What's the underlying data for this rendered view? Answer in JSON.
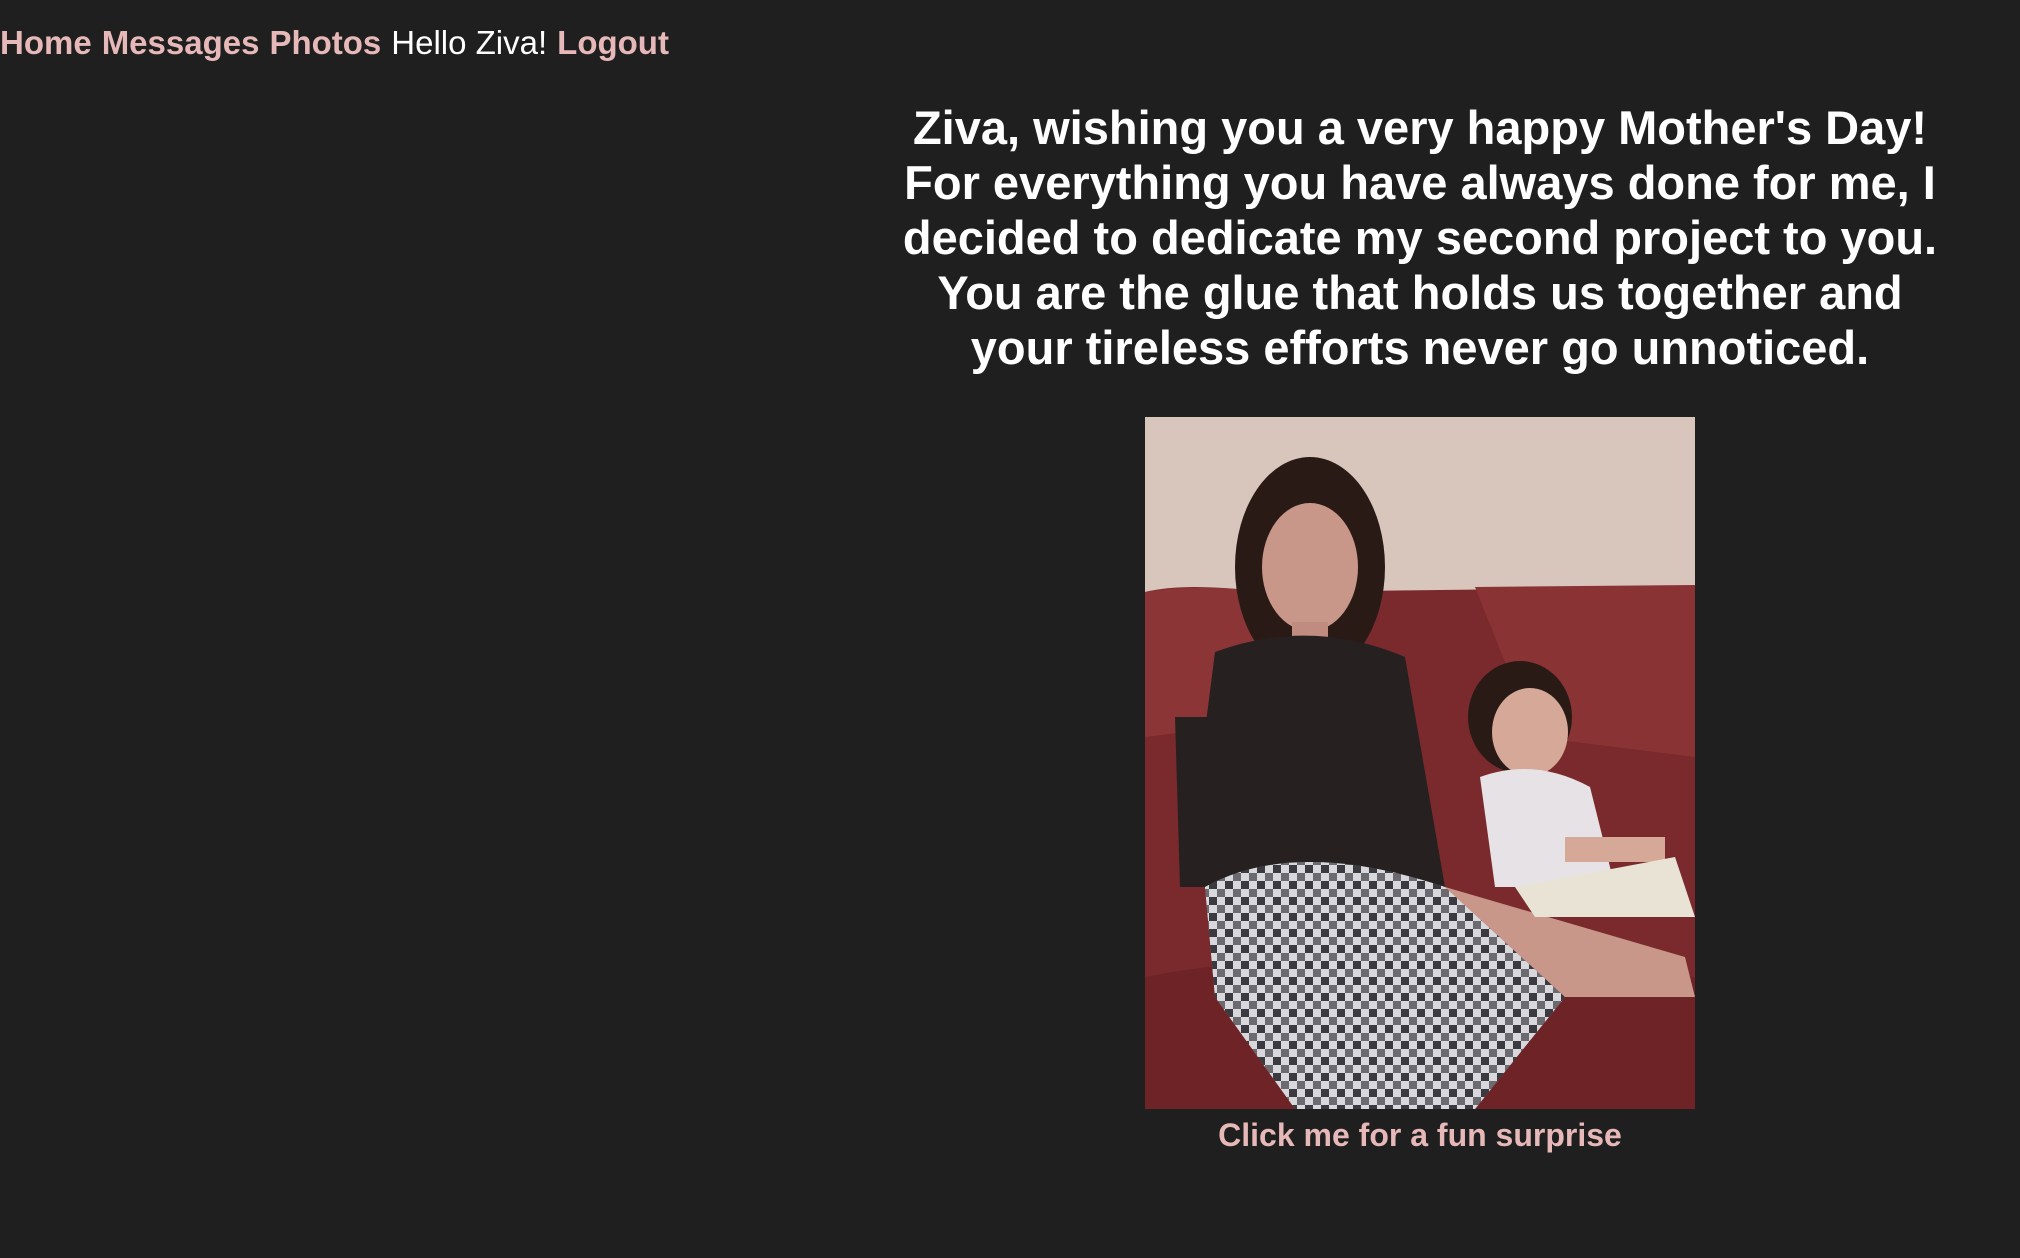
{
  "nav": {
    "home": "Home",
    "messages": "Messages",
    "photos": "Photos",
    "greeting": "Hello Ziva!",
    "logout": "Logout"
  },
  "main": {
    "message": "Ziva, wishing you a very happy Mother's Day! For everything you have always done for me, I decided to dedicate my second project to you. You are the glue that holds us together and your tireless efforts never go unnoticed.",
    "surprise_link": "Click me for a fun surprise"
  },
  "colors": {
    "background": "#1f1f1f",
    "link": "#e6b8b8",
    "text": "#ffffff"
  }
}
